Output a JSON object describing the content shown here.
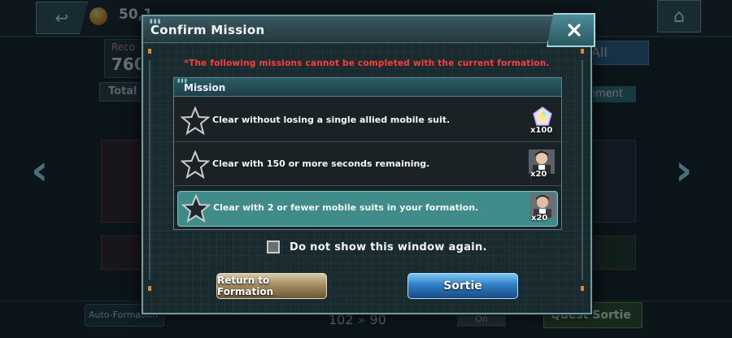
{
  "background": {
    "currency_count": "50,1",
    "record_label": "Reco",
    "record_value": "760",
    "total_label": "Total C",
    "all_label": "All",
    "arrangement_label": "ement",
    "auto_formation_label": "Auto-Formation",
    "cost_current": "102",
    "cost_max": "90",
    "toggle_label": "On",
    "quest_sortie_label": "Quest Sortie"
  },
  "dialog": {
    "title": "Confirm Mission",
    "warning": "*The following missions cannot be completed with the current formation.",
    "mission_header": "Mission",
    "missions": [
      {
        "text": "Clear without losing a single allied mobile suit.",
        "reward_qty": "x100",
        "reward_icon": "crystal-gem-icon",
        "highlighted": false
      },
      {
        "text": "Clear with 150 or more seconds remaining.",
        "reward_qty": "x20",
        "reward_icon": "pilot-portrait-icon",
        "highlighted": false
      },
      {
        "text": "Clear with 2 or fewer mobile suits in your formation.",
        "reward_qty": "x20",
        "reward_icon": "pilot-portrait-icon",
        "highlighted": true
      }
    ],
    "dont_show_label": "Do not show this window again.",
    "dont_show_checked": false,
    "return_button": "Return to Formation",
    "sortie_button": "Sortie"
  },
  "colors": {
    "warning": "#ff3d3d",
    "highlight_row": "#3f8c8a",
    "sortie_button": "#2e7fc4",
    "return_button": "#a48d62"
  }
}
